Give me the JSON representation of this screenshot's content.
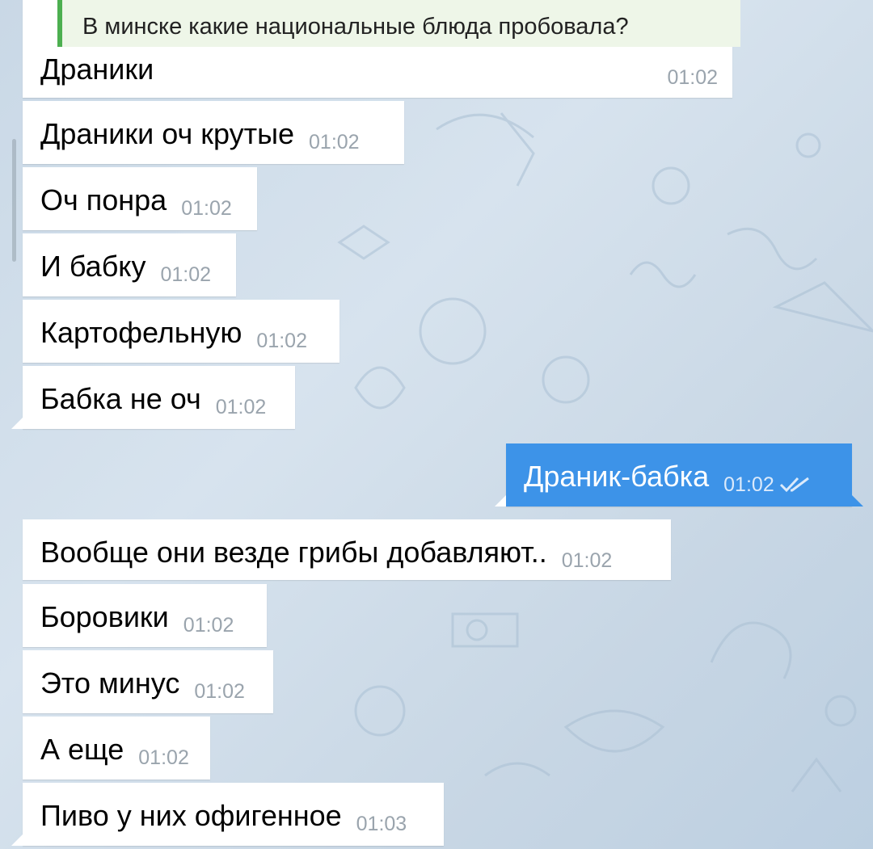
{
  "chat": {
    "reply_preview": {
      "quoted_text": "В минске какие национальные блюда пробовала?"
    },
    "messages": [
      {
        "text": "Драники",
        "time": "01:02",
        "direction": "in"
      },
      {
        "text": "Драники оч крутые",
        "time": "01:02",
        "direction": "in"
      },
      {
        "text": "Оч понра",
        "time": "01:02",
        "direction": "in"
      },
      {
        "text": "И бабку",
        "time": "01:02",
        "direction": "in"
      },
      {
        "text": "Картофельную",
        "time": "01:02",
        "direction": "in"
      },
      {
        "text": "Бабка не оч",
        "time": "01:02",
        "direction": "in"
      },
      {
        "text": "Драник-бабка",
        "time": "01:02",
        "direction": "out",
        "status": "read-double-check-icon"
      },
      {
        "text": "Вообще они везде грибы добавляют..",
        "time": "01:02",
        "direction": "in"
      },
      {
        "text": "Боровики",
        "time": "01:02",
        "direction": "in"
      },
      {
        "text": "Это минус",
        "time": "01:02",
        "direction": "in"
      },
      {
        "text": "А еще",
        "time": "01:02",
        "direction": "in"
      },
      {
        "text": "Пиво у них офигенное",
        "time": "01:03",
        "direction": "in"
      }
    ]
  },
  "colors": {
    "outgoing_bubble": "#3d93e8",
    "incoming_bubble": "#ffffff",
    "reply_accent": "#4caf50",
    "timestamp": "#9aa4ad"
  }
}
